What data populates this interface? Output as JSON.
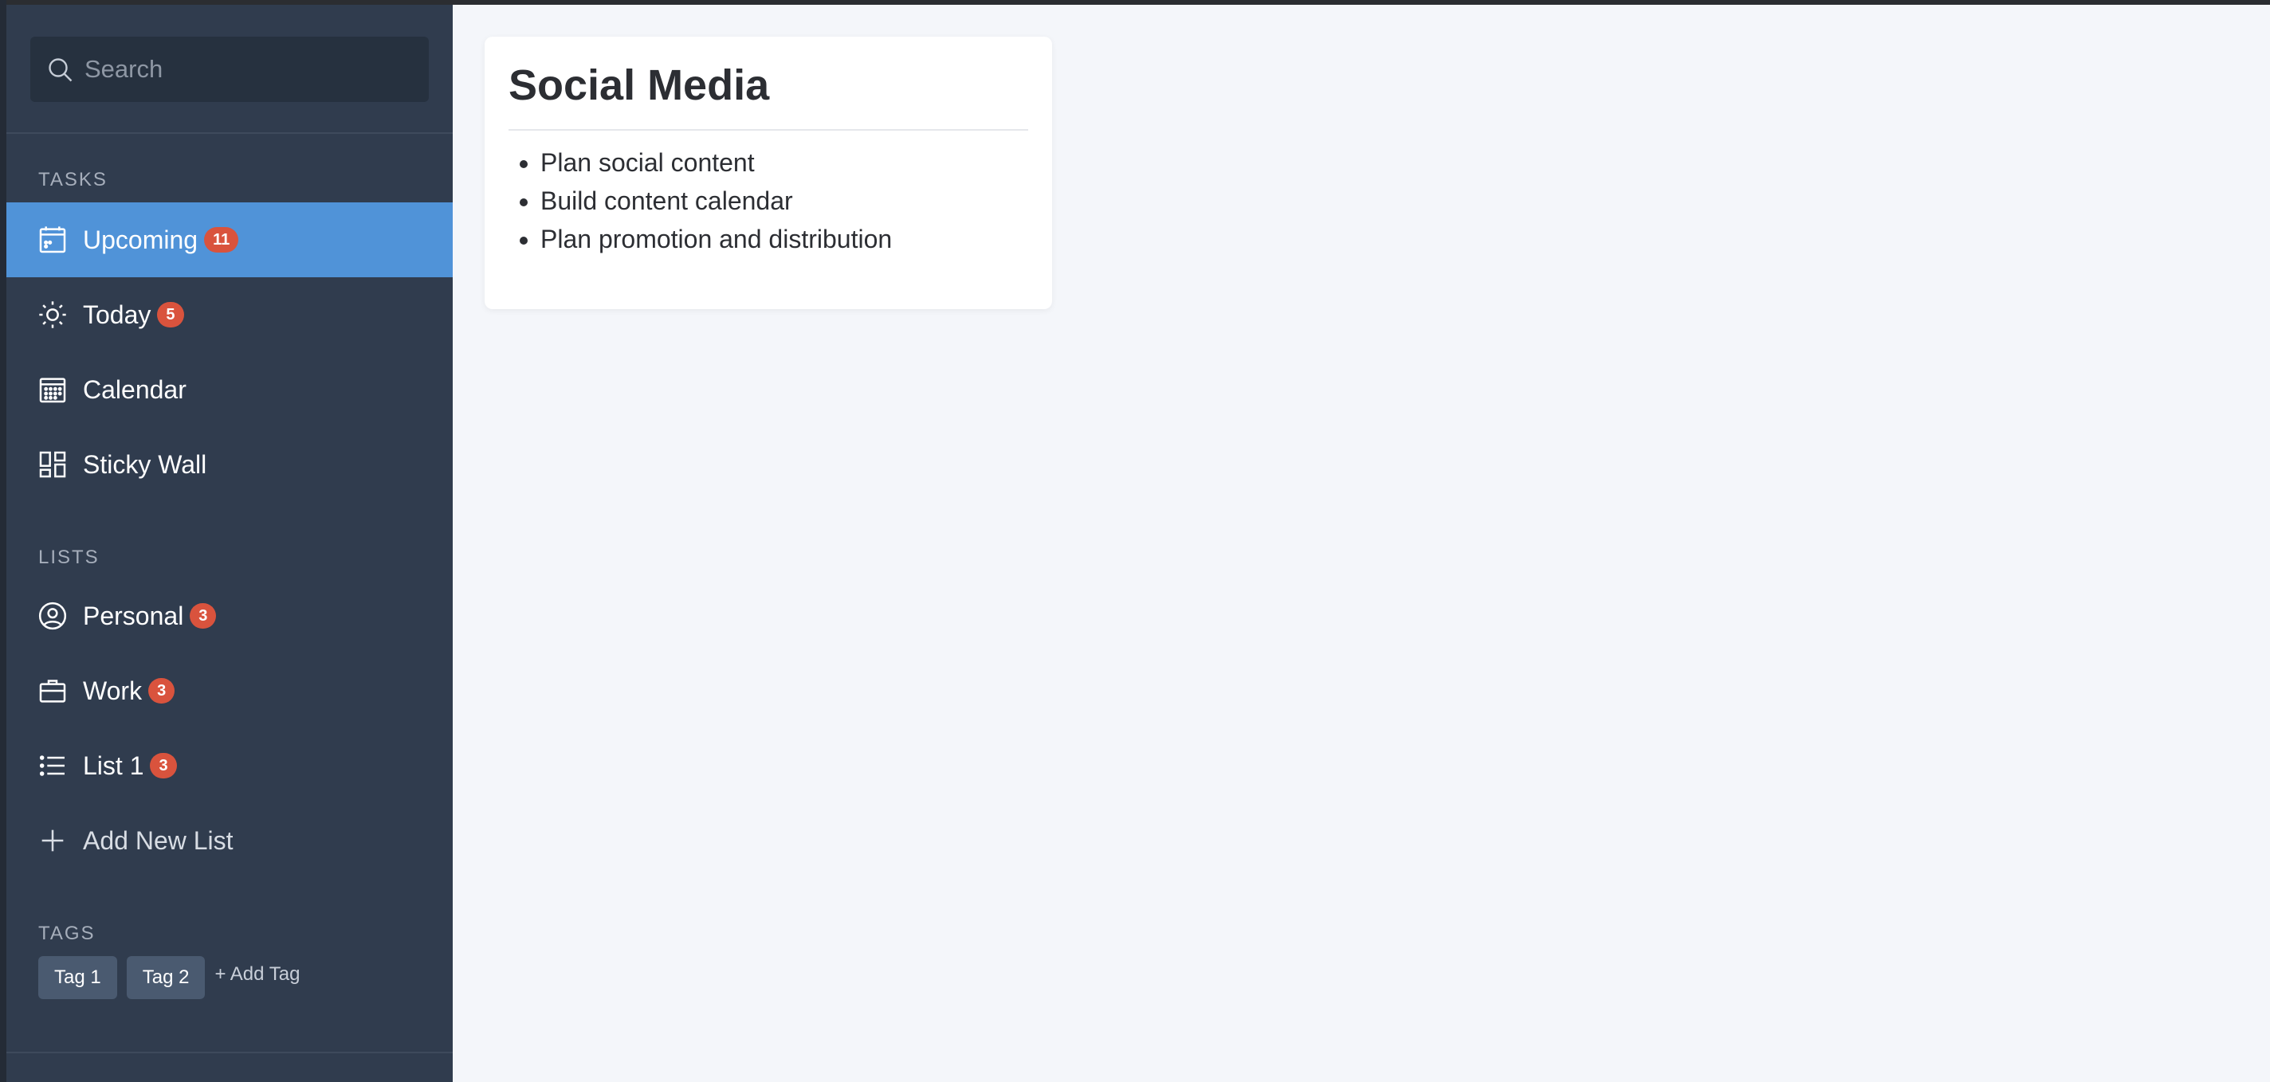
{
  "search": {
    "placeholder": "Search"
  },
  "sections": {
    "tasks": "TASKS",
    "lists": "LISTS",
    "tags": "TAGS"
  },
  "tasks": [
    {
      "label": "Upcoming",
      "badge": "11",
      "icon": "calendar-upcoming-icon",
      "active": true
    },
    {
      "label": "Today",
      "badge": "5",
      "icon": "sun-icon",
      "active": false
    },
    {
      "label": "Calendar",
      "badge": "",
      "icon": "calendar-grid-icon",
      "active": false
    },
    {
      "label": "Sticky Wall",
      "badge": "",
      "icon": "sticky-wall-icon",
      "active": false
    }
  ],
  "lists": [
    {
      "label": "Personal",
      "badge": "3",
      "icon": "user-circle-icon"
    },
    {
      "label": "Work",
      "badge": "3",
      "icon": "briefcase-icon"
    },
    {
      "label": "List 1",
      "badge": "3",
      "icon": "list-icon"
    },
    {
      "label": "Add New List",
      "icon": "plus-icon"
    }
  ],
  "tags": {
    "items": [
      "Tag 1",
      "Tag 2"
    ],
    "add_label": "+ Add Tag"
  },
  "card": {
    "title": "Social Media",
    "items": [
      "Plan social content",
      "Build content calendar",
      "Plan promotion and distribution"
    ]
  },
  "colors": {
    "sidebar_bg": "#303c4e",
    "active_item": "#5093d8",
    "badge": "#d9533d",
    "main_bg": "#f4f6fa"
  }
}
